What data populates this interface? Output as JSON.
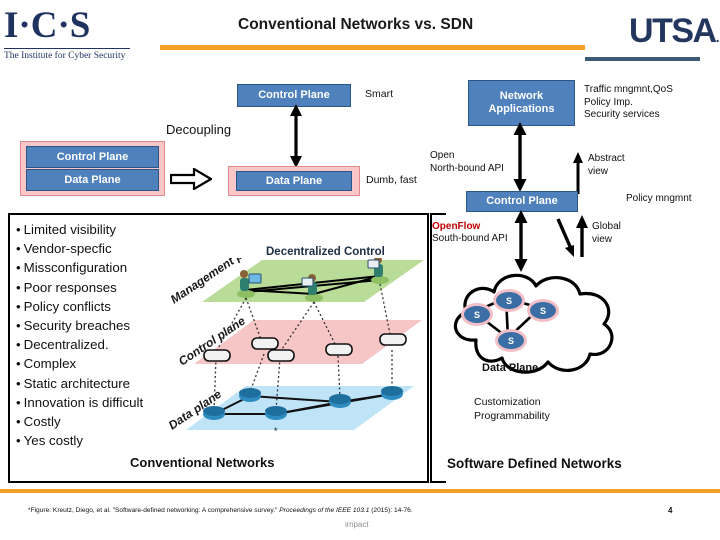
{
  "header": {
    "ics_logo_text": "I·C·S",
    "ics_tagline": "The Institute for Cyber Security",
    "title": "Conventional Networks vs. SDN",
    "utsa_logo_text": "UTSA",
    "utsa_logo_dot": ".",
    "accent_color": "#f5a127",
    "brand_navy": "#22365e"
  },
  "decoupling": {
    "control_plane_label": "Control Plane",
    "data_plane_label": "Data Plane",
    "smart_label": "Smart",
    "dumb_fast_label": "Dumb, fast",
    "decoupling_label": "Decoupling",
    "stack_control_plane": "Control Plane",
    "stack_data_plane": "Data Plane"
  },
  "conventional": {
    "panel_title": "Conventional Networks",
    "decentralized_label": "Decentralized Control",
    "bullets": [
      "Limited visibility",
      "Vendor-specfic",
      "Missconfiguration",
      "Poor responses",
      "Policy conflicts",
      "Security breaches",
      "Decentralized.",
      "Complex",
      "Static architecture",
      "Innovation is difficult",
      "Costly",
      "Yes costly"
    ],
    "planes": [
      {
        "name": "Management plane",
        "color": "#b9dd98"
      },
      {
        "name": "Control plane",
        "color": "#f6c5c5"
      },
      {
        "name": "Data plane",
        "color": "#bfe3f7"
      }
    ]
  },
  "sdn": {
    "panel_title": "Software Defined Networks",
    "network_applications_label": "Network\nApplications",
    "app_services": [
      "Traffic mngmnt,QoS",
      "Policy Imp.",
      "Security services"
    ],
    "northbound_api": [
      "Open",
      "North-bound API"
    ],
    "abstract_view": [
      "Abstract",
      "view"
    ],
    "control_plane_label": "Control Plane",
    "policy_mngmnt_label": "Policy mngmnt",
    "openflow_label": "OpenFlow",
    "openflow_color": "#c00000",
    "southbound_api": "South-bound API",
    "global_view": [
      "Global",
      "view"
    ],
    "cloud_data_plane_label": "Data Plane",
    "switch_label": "S",
    "switch_count": 4,
    "customization": [
      "Customization",
      "Programmability"
    ]
  },
  "footer": {
    "footnote_prefix": "*Figure: Kreutz, Diego, et al. \"Software-defined networking: A comprehensive survey.\" ",
    "footnote_italic": "Proceedings of the IEEE 103.1",
    "footnote_suffix": " (2015): 14-76.",
    "impact_text": "impact",
    "slide_number": "4"
  }
}
